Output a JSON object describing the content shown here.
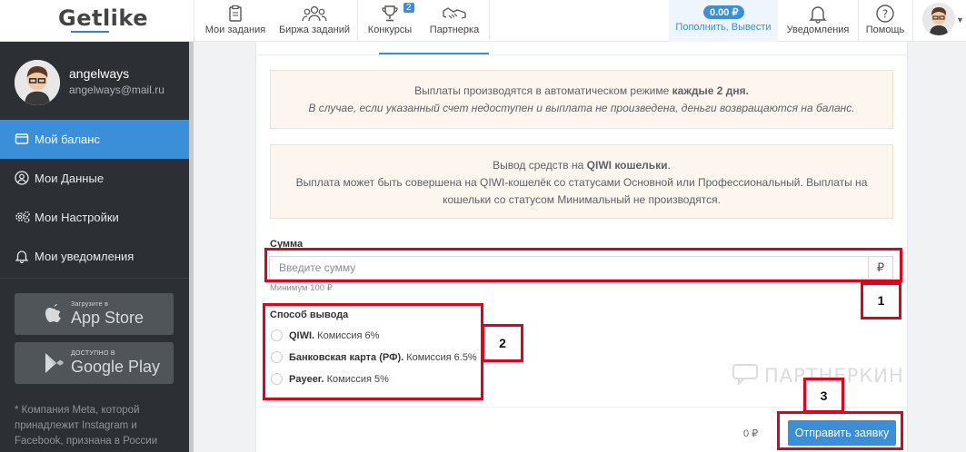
{
  "brand": {
    "logo": "Getlike"
  },
  "topnav": {
    "items": [
      {
        "label": "Мои задания",
        "icon": "clipboard-icon"
      },
      {
        "label": "Биржа заданий",
        "icon": "people-icon"
      },
      {
        "label": "Конкурсы",
        "icon": "trophy-icon",
        "badge": "2"
      },
      {
        "label": "Партнерка",
        "icon": "handshake-icon"
      }
    ],
    "balance": {
      "amount": "0.00 ₽",
      "link": "Пополнить, Вывести"
    },
    "notifications": "Уведомления",
    "help": "Помощь"
  },
  "sidebar": {
    "user": {
      "name": "angelways",
      "email": "angelways@mail.ru"
    },
    "items": [
      {
        "label": "Мой баланс",
        "icon": "wallet-icon",
        "active": true
      },
      {
        "label": "Мои Данные",
        "icon": "user-icon"
      },
      {
        "label": "Мои Настройки",
        "icon": "gears-icon"
      },
      {
        "label": "Мои уведомления",
        "icon": "bell-icon"
      }
    ],
    "appstore": {
      "small": "Загрузите в",
      "big": "App Store"
    },
    "googleplay": {
      "small": "ДОСТУПНО В",
      "big": "Google Play"
    },
    "notice": "* Компания Meta, которой принадлежит Instagram и Facebook, признана в России"
  },
  "main": {
    "alert1": {
      "line1_pre": "Выплаты производятся в автоматическом режиме",
      "line1_bold": "каждые 2 дня.",
      "line2": "В случае, если указанный счет недоступен и выплата не произведена, деньги возвращаются на баланс."
    },
    "alert2": {
      "line1_pre": "Вывод средств на",
      "line1_bold": "QIWI кошельки",
      "line1_post": ".",
      "line2": "Выплата может быть совершена на QIWI-кошелёк со статусами Основной или Профессиональный. Выплаты на",
      "line3": "кошельки со статусом Минимальный не производятся."
    },
    "amount": {
      "label": "Сумма",
      "placeholder": "Введите сумму",
      "currency": "₽",
      "hint": "Минимум 100 ₽"
    },
    "method": {
      "label": "Способ вывода",
      "options": [
        {
          "name": "QIWI.",
          "fee": "Комиссия 6%"
        },
        {
          "name": "Банковская карта (РФ).",
          "fee": "Комиссия 6.5%"
        },
        {
          "name": "Payeer.",
          "fee": "Комиссия 5%"
        }
      ]
    },
    "total": "0 ₽",
    "submit": "Отправить заявку"
  },
  "annotations": {
    "box1": "1",
    "box2": "2",
    "box3": "3",
    "accent": "#e3001b"
  },
  "watermark": "ПАРТНЕРКИН",
  "colors": {
    "accent": "#3a8fd8",
    "sidebar": "#2c3035",
    "alert_bg": "#fcf6ee"
  }
}
